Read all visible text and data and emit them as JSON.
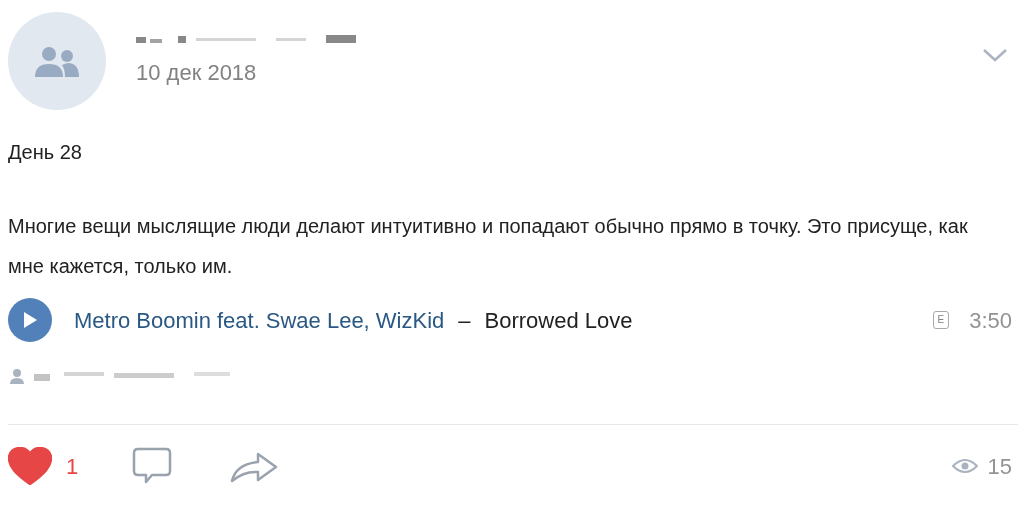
{
  "post": {
    "date": "10 дек 2018",
    "title": "День 28",
    "text": "Многие вещи мыслящие люди делают интуитивно и попадают обычно прямо в точку. Это присуще, как мне кажется, только им."
  },
  "audio": {
    "artist": "Metro Boomin",
    "feat": "feat.",
    "guests": "Swae Lee, WizKid",
    "separator": "–",
    "title": "Borrowed Love",
    "explicit_badge": "E",
    "duration": "3:50"
  },
  "actions": {
    "liked": true,
    "likes": "1",
    "views": "15"
  }
}
